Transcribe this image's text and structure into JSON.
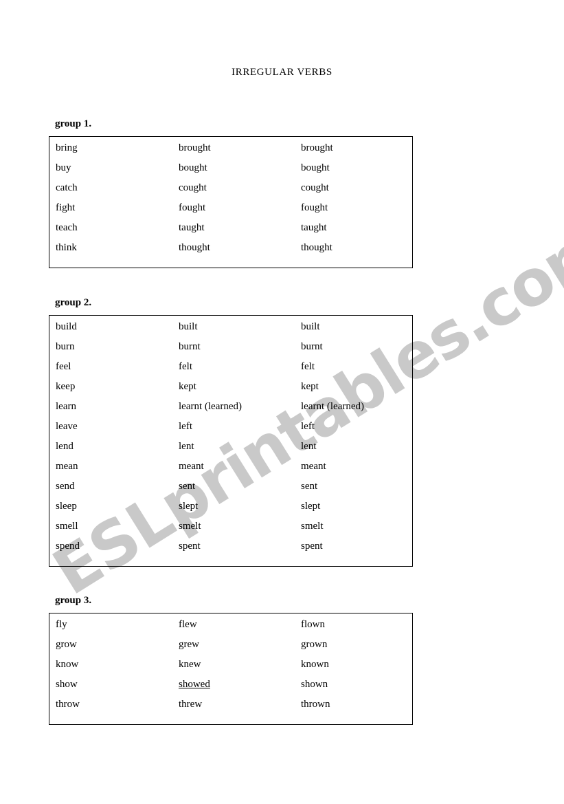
{
  "document": {
    "title": "IRREGULAR VERBS",
    "watermark": "ESLprintables.com",
    "watermark_color": "#c9c9c9",
    "text_color": "#000000",
    "background_color": "#ffffff",
    "border_color": "#000000"
  },
  "groups": [
    {
      "heading": "group 1.",
      "rows": [
        {
          "base": "bring",
          "past": "brought",
          "participle": "brought"
        },
        {
          "base": "buy",
          "past": "bought",
          "participle": "bought"
        },
        {
          "base": "catch",
          "past": "cought",
          "participle": "cought"
        },
        {
          "base": "fight",
          "past": "fought",
          "participle": "fought"
        },
        {
          "base": "teach",
          "past": "taught",
          "participle": "taught"
        },
        {
          "base": "think",
          "past": "thought",
          "participle": "thought"
        }
      ]
    },
    {
      "heading": "group 2.",
      "rows": [
        {
          "base": "build",
          "past": "built",
          "participle": "built"
        },
        {
          "base": "burn",
          "past": "burnt",
          "participle": "burnt"
        },
        {
          "base": "feel",
          "past": "felt",
          "participle": "felt"
        },
        {
          "base": "keep",
          "past": "kept",
          "participle": "kept"
        },
        {
          "base": "learn",
          "past": "learnt (learned)",
          "participle": "learnt (learned)"
        },
        {
          "base": "leave",
          "past": "left",
          "participle": "left"
        },
        {
          "base": "lend",
          "past": "lent",
          "participle": "lent"
        },
        {
          "base": "mean",
          "past": "meant",
          "participle": "meant"
        },
        {
          "base": "send",
          "past": "sent",
          "participle": "sent"
        },
        {
          "base": "sleep",
          "past": "slept",
          "participle": "slept"
        },
        {
          "base": "smell",
          "past": "smelt",
          "participle": "smelt"
        },
        {
          "base": "spend",
          "past": "spent",
          "participle": "spent"
        }
      ]
    },
    {
      "heading": "group 3.",
      "rows": [
        {
          "base": "fly",
          "past": "flew",
          "participle": "flown"
        },
        {
          "base": "grow",
          "past": "grew",
          "participle": "grown"
        },
        {
          "base": "know",
          "past": "knew",
          "participle": "known"
        },
        {
          "base": "show",
          "past": "showed",
          "participle": "shown",
          "past_underlined": true
        },
        {
          "base": "throw",
          "past": "threw",
          "participle": "thrown"
        }
      ]
    }
  ]
}
